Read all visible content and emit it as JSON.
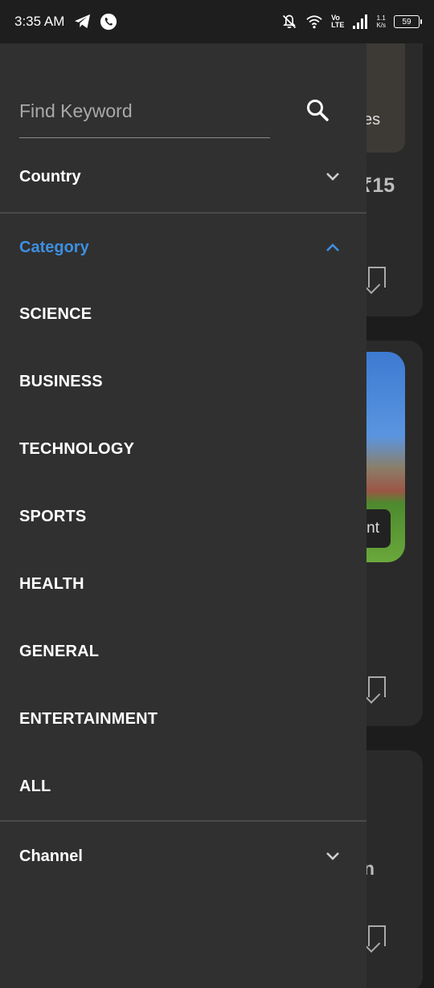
{
  "status_bar": {
    "time": "3:35 AM",
    "net_speed_value": "1.1",
    "net_speed_unit": "K/s",
    "volte_top": "Vo",
    "volte_bottom": "LTE",
    "battery": "59"
  },
  "background_app": {
    "thumb_text": "es",
    "price": "₹15",
    "chip_text": "nt",
    "fragment_text": "n"
  },
  "drawer": {
    "search": {
      "placeholder": "Find Keyword",
      "value": ""
    },
    "country": {
      "label": "Country",
      "expanded": false
    },
    "category": {
      "label": "Category",
      "expanded": true,
      "accent_color": "#3d8fe0",
      "items": [
        "SCIENCE",
        "BUSINESS",
        "TECHNOLOGY",
        "SPORTS",
        "HEALTH",
        "GENERAL",
        "ENTERTAINMENT",
        "ALL"
      ]
    },
    "channel": {
      "label": "Channel",
      "expanded": false
    }
  }
}
